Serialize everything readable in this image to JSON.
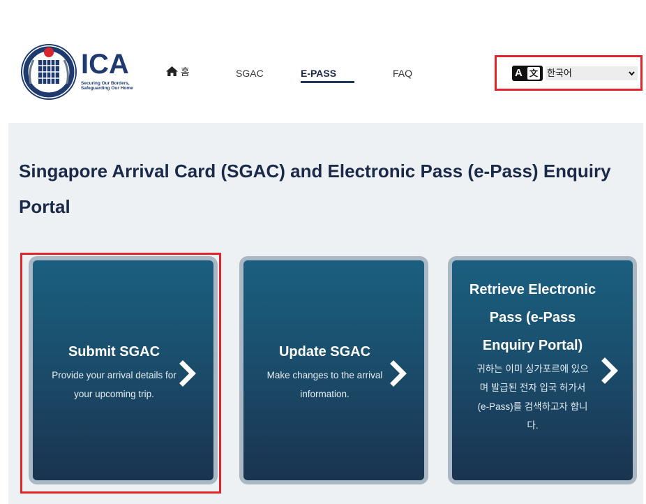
{
  "header": {
    "logo": {
      "wordmark": "ICA",
      "tagline_1": "Securing Our Borders,",
      "tagline_2": "Safeguarding Our Home"
    },
    "nav": {
      "home_label": "홈",
      "sgac_label": "SGAC",
      "epass_label": "E-PASS",
      "faq_label": "FAQ",
      "active": "E-PASS"
    },
    "language": {
      "icon": "translate-icon",
      "selected": "한국어"
    }
  },
  "main": {
    "title": "Singapore Arrival Card (SGAC) and Electronic Pass (e-Pass) Enquiry Portal",
    "cards": [
      {
        "title": "Submit SGAC",
        "description": "Provide your arrival details for your upcoming trip.",
        "icon": "chevron-right-icon"
      },
      {
        "title": "Update SGAC",
        "description": "Make changes to the arrival information.",
        "icon": "chevron-right-icon"
      },
      {
        "title": "Retrieve Electronic Pass (e-Pass Enquiry Portal)",
        "description_1": "귀하는 이미 싱가포르에 있으",
        "description_2": "며 발급된 전자 입국 허가서",
        "description_3": "(e-Pass)를 검색하고자 합니",
        "description_4": "다.",
        "icon": "chevron-right-icon"
      }
    ]
  },
  "colors": {
    "highlight": "#e3242b",
    "card_top": "#1b5f80",
    "card_bottom": "#1a3350",
    "panel_bg": "#eef1f4",
    "brand": "#1e3a6e"
  }
}
